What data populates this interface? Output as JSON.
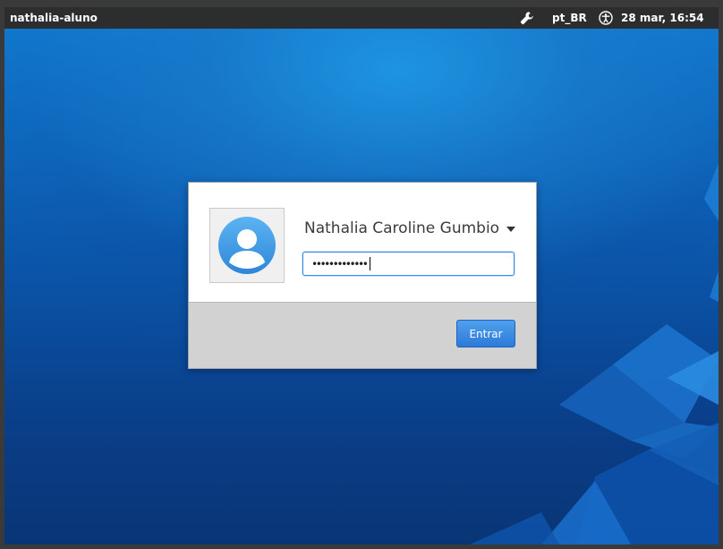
{
  "topbar": {
    "hostname": "nathalia-aluno",
    "tools_icon": "wrench-icon",
    "language": "pt_BR",
    "accessibility_icon": "accessibility-icon",
    "clock": "28 mar, 16:54"
  },
  "login": {
    "avatar_icon": "user-avatar-icon",
    "user_name": "Nathalia Caroline Gumbio",
    "password_masked": "•••••••••••••",
    "submit_label": "Entrar"
  },
  "colors": {
    "topbar": "#2c2d2f",
    "accent": "#3d8be0",
    "desktop_top": "#1180d6",
    "desktop_bottom": "#093575",
    "dialog_footer": "#d2d2d2"
  }
}
